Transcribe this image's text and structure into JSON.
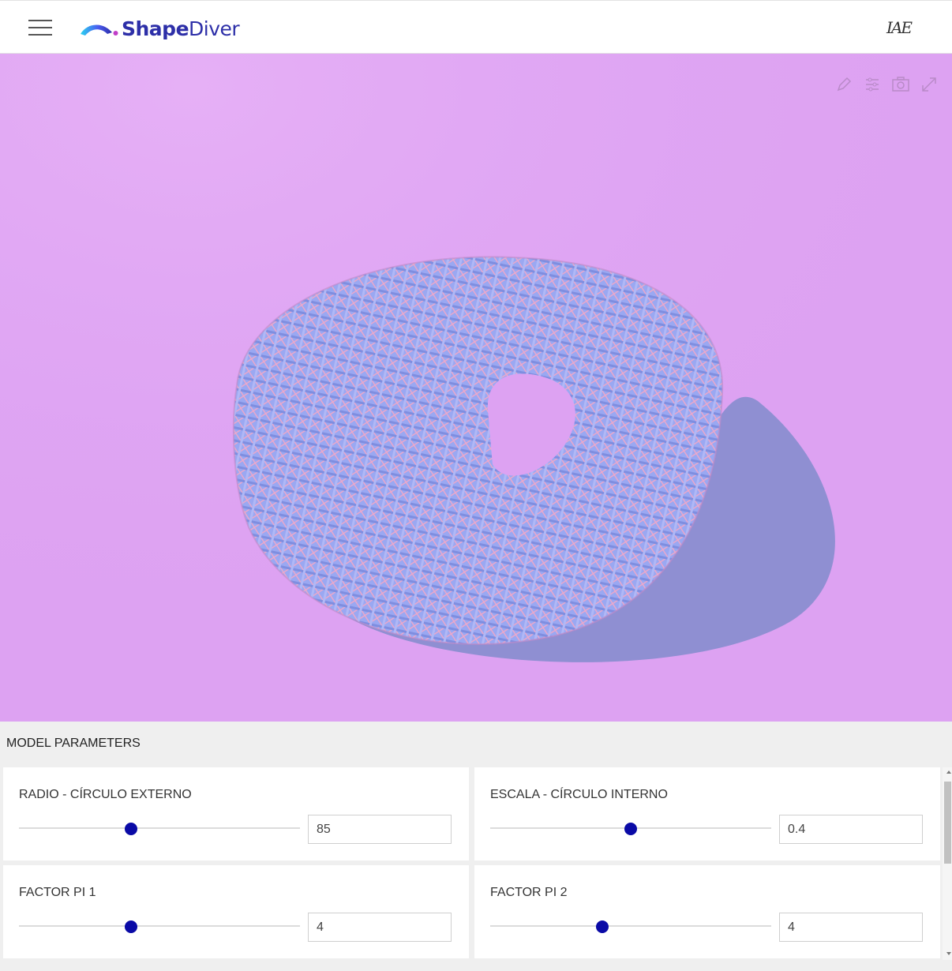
{
  "header": {
    "logo_text_bold": "Shape",
    "logo_text_regular": "Diver",
    "brand_mark": "IAE",
    "menu_icon": "hamburger-menu-icon"
  },
  "viewport": {
    "background_color": "#dda2f2",
    "tools": [
      {
        "name": "edit",
        "icon": "pencil-icon"
      },
      {
        "name": "settings",
        "icon": "sliders-icon"
      },
      {
        "name": "screenshot",
        "icon": "camera-icon"
      },
      {
        "name": "fullscreen",
        "icon": "expand-icon"
      }
    ]
  },
  "parameters": {
    "title": "MODEL PARAMETERS",
    "items": [
      {
        "label": "RADIO - CÍRCULO EXTERNO",
        "value": "85",
        "slider_fraction": 0.4
      },
      {
        "label": "ESCALA - CÍRCULO INTERNO",
        "value": "0.4",
        "slider_fraction": 0.5
      },
      {
        "label": "FACTOR PI 1",
        "value": "4",
        "slider_fraction": 0.4
      },
      {
        "label": "FACTOR PI 2",
        "value": "4",
        "slider_fraction": 0.4
      }
    ],
    "accent_color": "#0a0aa6"
  }
}
